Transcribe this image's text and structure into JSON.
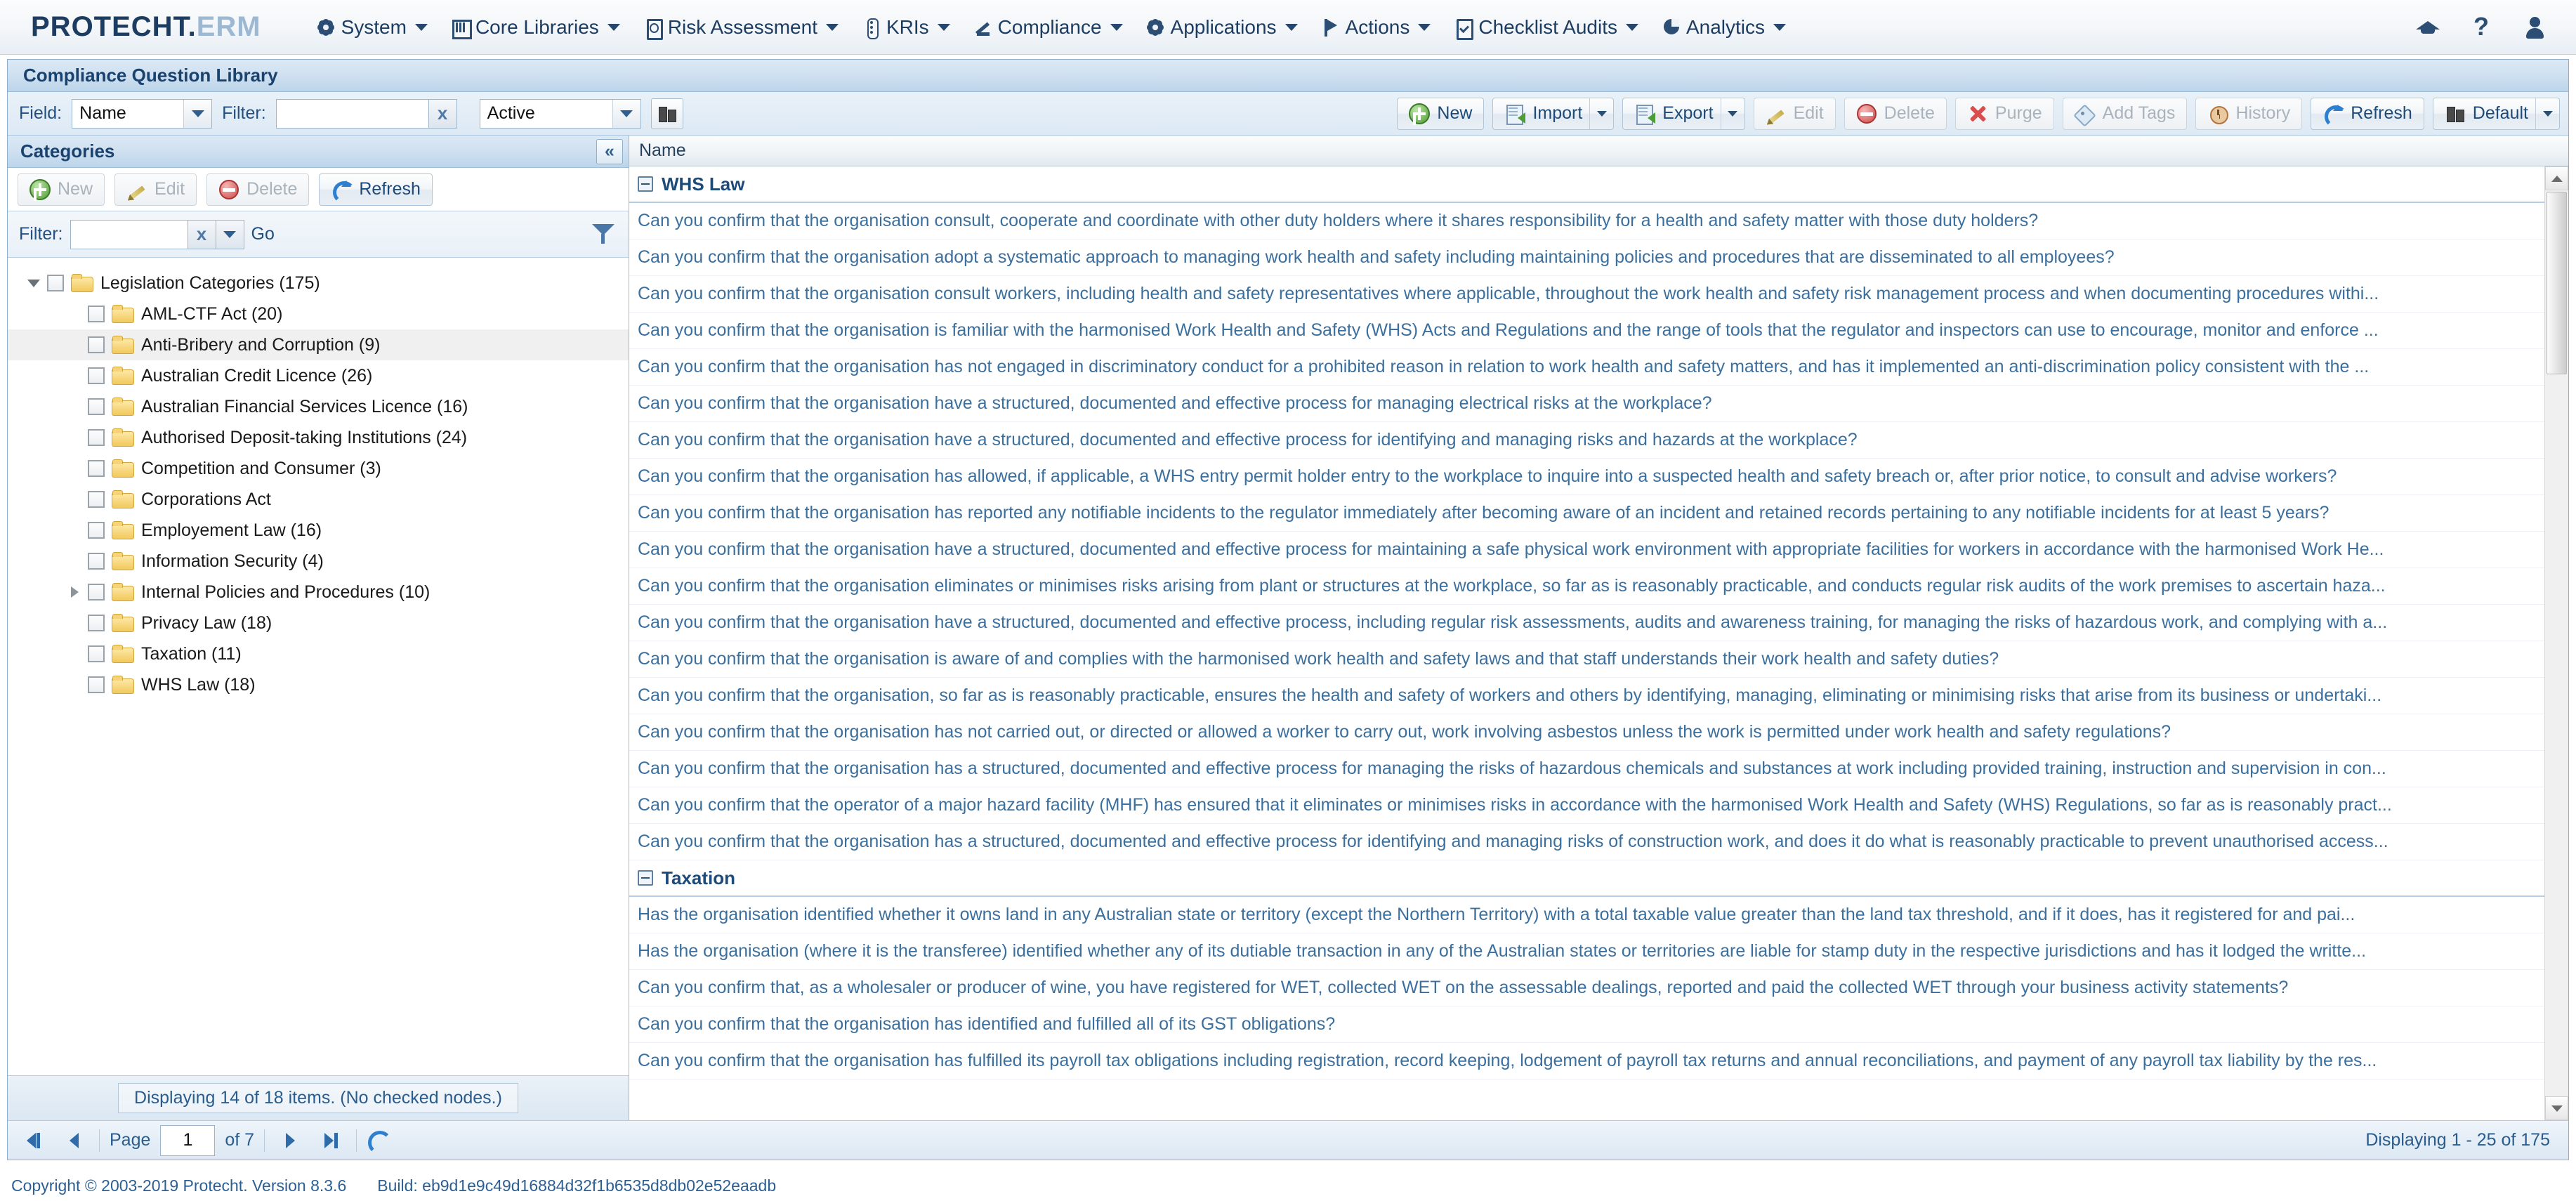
{
  "topbar": {
    "brand_main": "PROTECHT",
    "brand_dot": ".",
    "brand_sub": "ERM",
    "menu": [
      {
        "label": "System",
        "icon": "gear-icon"
      },
      {
        "label": "Core Libraries",
        "icon": "library-icon"
      },
      {
        "label": "Risk Assessment",
        "icon": "clipboard-icon"
      },
      {
        "label": "KRIs",
        "icon": "traffic-light-icon"
      },
      {
        "label": "Compliance",
        "icon": "gavel-icon"
      },
      {
        "label": "Applications",
        "icon": "gear-icon"
      },
      {
        "label": "Actions",
        "icon": "flag-icon"
      },
      {
        "label": "Checklist Audits",
        "icon": "checklist-icon"
      },
      {
        "label": "Analytics",
        "icon": "pie-chart-icon"
      }
    ],
    "right_icons": [
      "graduation-cap-icon",
      "help-question-icon",
      "user-avatar-icon"
    ],
    "help_glyph": "?"
  },
  "page": {
    "title": "Compliance Question Library"
  },
  "toolbar": {
    "field_label": "Field:",
    "field_value": "Name",
    "filter_label": "Filter:",
    "filter_value": "",
    "filter_placeholder": "",
    "clear_glyph": "x",
    "status_value": "Active",
    "search_icon": "binoculars-icon",
    "buttons": [
      {
        "label": "New",
        "icon": "new-plus-icon",
        "disabled": false,
        "split": false
      },
      {
        "label": "Import",
        "icon": "import-doc-icon",
        "disabled": false,
        "split": true
      },
      {
        "label": "Export",
        "icon": "export-doc-icon",
        "disabled": false,
        "split": true
      },
      {
        "label": "Edit",
        "icon": "pencil-icon",
        "disabled": true,
        "split": false
      },
      {
        "label": "Delete",
        "icon": "delete-circle-icon",
        "disabled": true,
        "split": false
      },
      {
        "label": "Purge",
        "icon": "purge-x-icon",
        "disabled": true,
        "split": false
      },
      {
        "label": "Add Tags",
        "icon": "tag-icon",
        "disabled": true,
        "split": false
      },
      {
        "label": "History",
        "icon": "history-clock-icon",
        "disabled": true,
        "split": false
      },
      {
        "label": "Refresh",
        "icon": "refresh-icon",
        "disabled": false,
        "split": false
      },
      {
        "label": "Default",
        "icon": "binoculars-icon",
        "disabled": false,
        "split": true
      }
    ]
  },
  "categories": {
    "header": "Categories",
    "collapse_glyph": "«",
    "buttons": [
      {
        "label": "New",
        "icon": "new-plus-icon",
        "disabled": true
      },
      {
        "label": "Edit",
        "icon": "pencil-icon",
        "disabled": true
      },
      {
        "label": "Delete",
        "icon": "delete-circle-icon",
        "disabled": true
      },
      {
        "label": "Refresh",
        "icon": "refresh-icon",
        "disabled": false
      }
    ],
    "filter_label": "Filter:",
    "filter_value": "",
    "clear_glyph": "x",
    "go_label": "Go",
    "tree": [
      {
        "label": "Legislation Categories (175)",
        "level": 0,
        "twist": "down",
        "hovered": false
      },
      {
        "label": "AML-CTF Act (20)",
        "level": 1,
        "twist": "none",
        "hovered": false
      },
      {
        "label": "Anti-Bribery and Corruption (9)",
        "level": 1,
        "twist": "none",
        "hovered": true
      },
      {
        "label": "Australian Credit Licence (26)",
        "level": 1,
        "twist": "none",
        "hovered": false
      },
      {
        "label": "Australian Financial Services Licence (16)",
        "level": 1,
        "twist": "none",
        "hovered": false
      },
      {
        "label": "Authorised Deposit-taking Institutions (24)",
        "level": 1,
        "twist": "none",
        "hovered": false
      },
      {
        "label": "Competition and Consumer (3)",
        "level": 1,
        "twist": "none",
        "hovered": false
      },
      {
        "label": "Corporations Act",
        "level": 1,
        "twist": "none",
        "hovered": false
      },
      {
        "label": "Employement Law (16)",
        "level": 1,
        "twist": "none",
        "hovered": false
      },
      {
        "label": "Information Security (4)",
        "level": 1,
        "twist": "none",
        "hovered": false
      },
      {
        "label": "Internal Policies and Procedures (10)",
        "level": 1,
        "twist": "right",
        "hovered": false
      },
      {
        "label": "Privacy Law (18)",
        "level": 1,
        "twist": "none",
        "hovered": false
      },
      {
        "label": "Taxation (11)",
        "level": 1,
        "twist": "none",
        "hovered": false
      },
      {
        "label": "WHS Law (18)",
        "level": 1,
        "twist": "none",
        "hovered": false
      }
    ],
    "status": "Displaying 14 of 18 items. (No checked nodes.)"
  },
  "grid": {
    "column_header": "Name",
    "groups": [
      {
        "name": "WHS Law",
        "rows": [
          "Can you confirm that the organisation consult, cooperate and coordinate with other duty holders where it shares responsibility for a health and safety matter with those duty holders?",
          "Can you confirm that the organisation adopt a systematic approach to managing work health and safety including maintaining policies and procedures that are disseminated to all employees?",
          "Can you confirm that the organisation consult workers, including health and safety representatives where applicable, throughout the work health and safety risk management process and when documenting procedures withi...",
          "Can you confirm that the organisation is familiar with the harmonised Work Health and Safety (WHS) Acts and Regulations and the range of tools that the regulator and inspectors can use to encourage, monitor and enforce ...",
          "Can you confirm that the organisation has not engaged in discriminatory conduct for a prohibited reason in relation to work health and safety matters, and has it implemented an anti-discrimination policy consistent with the ...",
          "Can you confirm that the organisation have a structured, documented and effective process for managing electrical risks at the workplace?",
          "Can you confirm that the organisation have a structured, documented and effective process for identifying and managing risks and hazards at the workplace?",
          "Can you confirm that the organisation has allowed, if applicable, a WHS entry permit holder entry to the workplace to inquire into a suspected health and safety breach or, after prior notice, to consult and advise workers?",
          "Can you confirm that the organisation has reported any notifiable incidents to the regulator immediately after becoming aware of an incident and retained records pertaining to any notifiable incidents for at least 5 years?",
          "Can you confirm that the organisation have a structured, documented and effective process for maintaining a safe physical work environment with appropriate facilities for workers in accordance with the harmonised Work He...",
          "Can you confirm that the organisation eliminates or minimises risks arising from plant or structures at the workplace, so far as is reasonably practicable, and conducts regular risk audits of the work premises to ascertain haza...",
          "Can you confirm that the organisation have a structured, documented and effective process, including regular risk assessments, audits and awareness training, for managing the risks of hazardous work, and complying with a...",
          "Can you confirm that the organisation is aware of and complies with the harmonised work health and safety laws and that staff understands their work health and safety duties?",
          "Can you confirm that the organisation, so far as is reasonably practicable, ensures the health and safety of workers and others by identifying, managing, eliminating or minimising risks that arise from its business or undertaki...",
          "Can you confirm that the organisation has not carried out, or directed or allowed a worker to carry out, work involving asbestos unless the work is permitted under work health and safety regulations?",
          "Can you confirm that the organisation has a structured, documented and effective process for managing the risks of hazardous chemicals and substances at work including provided training, instruction and supervision in con...",
          "Can you confirm that the operator of a major hazard facility (MHF) has ensured that it eliminates or minimises risks in accordance with the harmonised Work Health and Safety (WHS) Regulations, so far as is reasonably pract...",
          "Can you confirm that the organisation has a structured, documented and effective process for identifying and managing risks of construction work, and does it do what is reasonably practicable to prevent unauthorised access..."
        ]
      },
      {
        "name": "Taxation",
        "rows": [
          "Has the organisation identified whether it owns land in any Australian state or territory (except the Northern Territory) with a total taxable value greater than the land tax threshold, and if it does, has it registered for and pai...",
          "Has the organisation (where it is the transferee) identified whether any of its dutiable transaction in any of the Australian states or territories are liable for stamp duty in the respective jurisdictions and has it lodged the writte...",
          "Can you confirm that, as a wholesaler or producer of wine, you have registered for WET, collected WET on the assessable dealings, reported and paid the collected WET through your business activity statements?",
          "Can you confirm that the organisation has identified and fulfilled all of its GST obligations?",
          "Can you confirm that the organisation has fulfilled its payroll tax obligations including registration, record keeping, lodgement of payroll tax returns and annual reconciliations, and payment of any payroll tax liability by the res..."
        ]
      }
    ]
  },
  "pager": {
    "page_label": "Page",
    "page_value": "1",
    "of_label": "of 7",
    "first_title": "first-page",
    "prev_title": "previous-page",
    "next_title": "next-page",
    "last_title": "last-page",
    "refresh_title": "refresh",
    "displaying": "Displaying 1 - 25 of 175"
  },
  "footer": {
    "copyright": "Copyright © 2003-2019 Protecht.  Version 8.3.6",
    "build": "Build: eb9d1e9c49d16884d32f1b6535d8db02e52eaadb"
  }
}
